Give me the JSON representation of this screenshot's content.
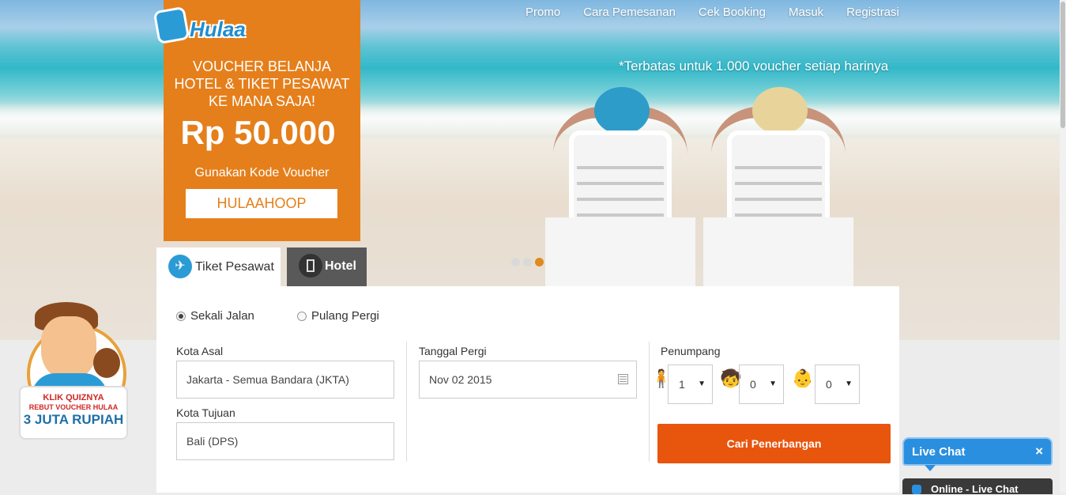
{
  "nav": {
    "items": [
      "Promo",
      "Cara Pemesanan",
      "Cek Booking",
      "Masuk",
      "Registrasi"
    ]
  },
  "brand": {
    "logo_text": "Hulaa"
  },
  "banner": {
    "limit_note": "*Terbatas untuk 1.000 voucher setiap harinya",
    "slider_dots": 3,
    "slider_active_index": 2
  },
  "promo": {
    "line1": "VOUCHER BELANJA",
    "line2": "HOTEL & TIKET PESAWAT",
    "line3": "KE MANA SAJA!",
    "price": "Rp 50.000",
    "use_code_label": "Gunakan Kode Voucher",
    "code": "HULAAHOOP",
    "bg_color": "#e57f1b"
  },
  "tabs": {
    "flight": "Tiket Pesawat",
    "hotel": "Hotel"
  },
  "search": {
    "trip_one_way": "Sekali Jalan",
    "trip_round": "Pulang Pergi",
    "origin_label": "Kota Asal",
    "origin_value": "Jakarta - Semua Bandara (JKTA)",
    "destination_label": "Kota Tujuan",
    "destination_value": "Bali (DPS)",
    "date_label": "Tanggal Pergi",
    "date_value": "Nov 02 2015",
    "passenger_label": "Penumpang",
    "adult_value": "1",
    "child_value": "0",
    "infant_value": "0",
    "submit_label": "Cari Penerbangan",
    "submit_color": "#e8550d"
  },
  "quiz": {
    "line1": "KLIK QUIZNYA",
    "line2": "REBUT VOUCHER HULAA",
    "line3": "3 JUTA RUPIAH"
  },
  "live_chat": {
    "title": "Live Chat",
    "close_glyph": "×",
    "status": "Online - Live Chat"
  }
}
